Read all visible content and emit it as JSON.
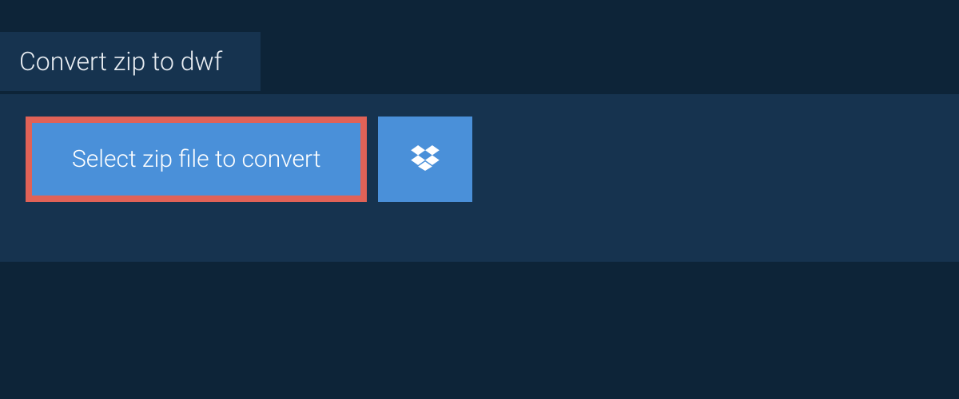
{
  "tab": {
    "title": "Convert zip to dwf"
  },
  "actions": {
    "select_label": "Select zip file to convert"
  }
}
